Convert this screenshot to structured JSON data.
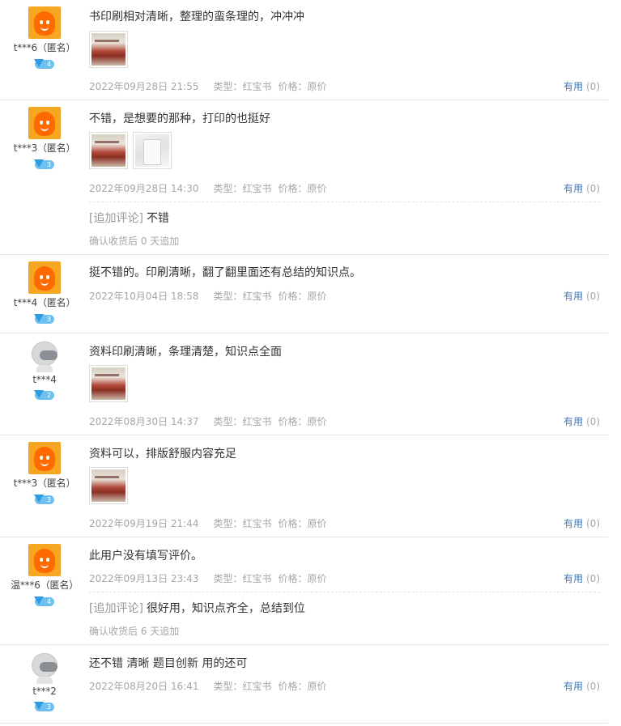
{
  "useful_label": "有用",
  "append_tag": "[追加评论]",
  "reviews": [
    {
      "user": "t***6（匿名）",
      "level": "4",
      "avatar": "orange",
      "text": "书印刷相对清晰，整理的蛮条理的，冲冲冲",
      "images": [
        "red"
      ],
      "date": "2022年09月28日 21:55",
      "type": "类型：红宝书",
      "price": "价格：原价",
      "useful_count": "(0)"
    },
    {
      "user": "t***3（匿名）",
      "level": "3",
      "avatar": "orange",
      "text": "不错，是想要的那种，打印的也挺好",
      "images": [
        "red",
        "white"
      ],
      "date": "2022年09月28日 14:30",
      "type": "类型：红宝书",
      "price": "价格：原价",
      "useful_count": "(0)",
      "append_text": "不错",
      "append_note": "确认收货后 0 天追加"
    },
    {
      "user": "t***4（匿名）",
      "level": "3",
      "avatar": "orange",
      "text": "挺不错的。印刷清晰，翻了翻里面还有总结的知识点。",
      "images": [],
      "date": "2022年10月04日 18:58",
      "type": "类型：红宝书",
      "price": "价格：原价",
      "useful_count": "(0)"
    },
    {
      "user": "t***4",
      "level": "2",
      "avatar": "grey",
      "text": "资料印刷清晰，条理清楚，知识点全面",
      "images": [
        "red"
      ],
      "date": "2022年08月30日 14:37",
      "type": "类型：红宝书",
      "price": "价格：原价",
      "useful_count": "(0)"
    },
    {
      "user": "t***3（匿名）",
      "level": "3",
      "avatar": "orange",
      "text": "资料可以，排版舒服内容充足",
      "images": [
        "red"
      ],
      "date": "2022年09月19日 21:44",
      "type": "类型：红宝书",
      "price": "价格：原价",
      "useful_count": "(0)"
    },
    {
      "user": "温***6（匿名）",
      "level": "4",
      "avatar": "orange",
      "text": "此用户没有填写评价。",
      "images": [],
      "date": "2022年09月13日 23:43",
      "type": "类型：红宝书",
      "price": "价格：原价",
      "useful_count": "(0)",
      "append_text": "很好用，知识点齐全，总结到位",
      "append_note": "确认收货后 6 天追加"
    },
    {
      "user": "t***2",
      "level": "3",
      "avatar": "grey",
      "text": "还不错 清晰 题目创新 用的还可",
      "images": [],
      "date": "2022年08月20日 16:41",
      "type": "类型：红宝书",
      "price": "价格：原价",
      "useful_count": "(0)"
    }
  ]
}
